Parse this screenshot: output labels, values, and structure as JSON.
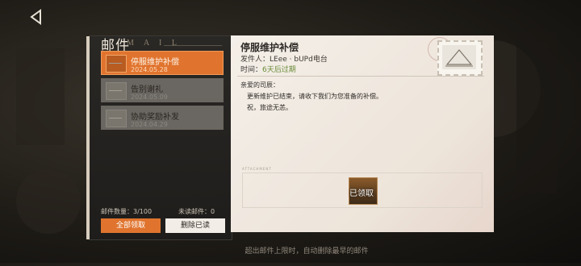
{
  "window": {
    "back_label": "◁"
  },
  "panel": {
    "title": "邮件",
    "subtitle": "M A I L",
    "items": [
      {
        "title": "停服维护补偿",
        "date": "2024.05.28",
        "state": "active"
      },
      {
        "title": "告别谢礼",
        "date": "2024.05.09",
        "state": "read"
      },
      {
        "title": "协助奖励补发",
        "date": "2024.04.29",
        "state": "read"
      }
    ],
    "count_label": "邮件数量：3/100",
    "unread_label": "未读邮件：0",
    "claim_all_label": "全部领取",
    "delete_read_label": "删除已读"
  },
  "letter": {
    "title": "停服维护补偿",
    "sender_label": "发件人：",
    "sender_value": "LEee · bUPd电台",
    "time_label": "时间：",
    "time_value": "6天后过期",
    "greeting": "亲爱的司辰：",
    "line1": "更新维护已结束，请收下我们为您准备的补偿。",
    "line2": "祝，旅途无恙。",
    "attachment_label": "ATTACHMENT",
    "attachment_status": "已领取"
  },
  "footer": {
    "note": "超出邮件上限时，自动删除最早的邮件"
  },
  "colors": {
    "accent": "#e0742e",
    "paper": "#f4efe8",
    "panel": "#2a2825",
    "expire": "#6a8b3a"
  },
  "icons": [
    "back-arrow-icon",
    "envelope-icon",
    "stamp-icon"
  ]
}
